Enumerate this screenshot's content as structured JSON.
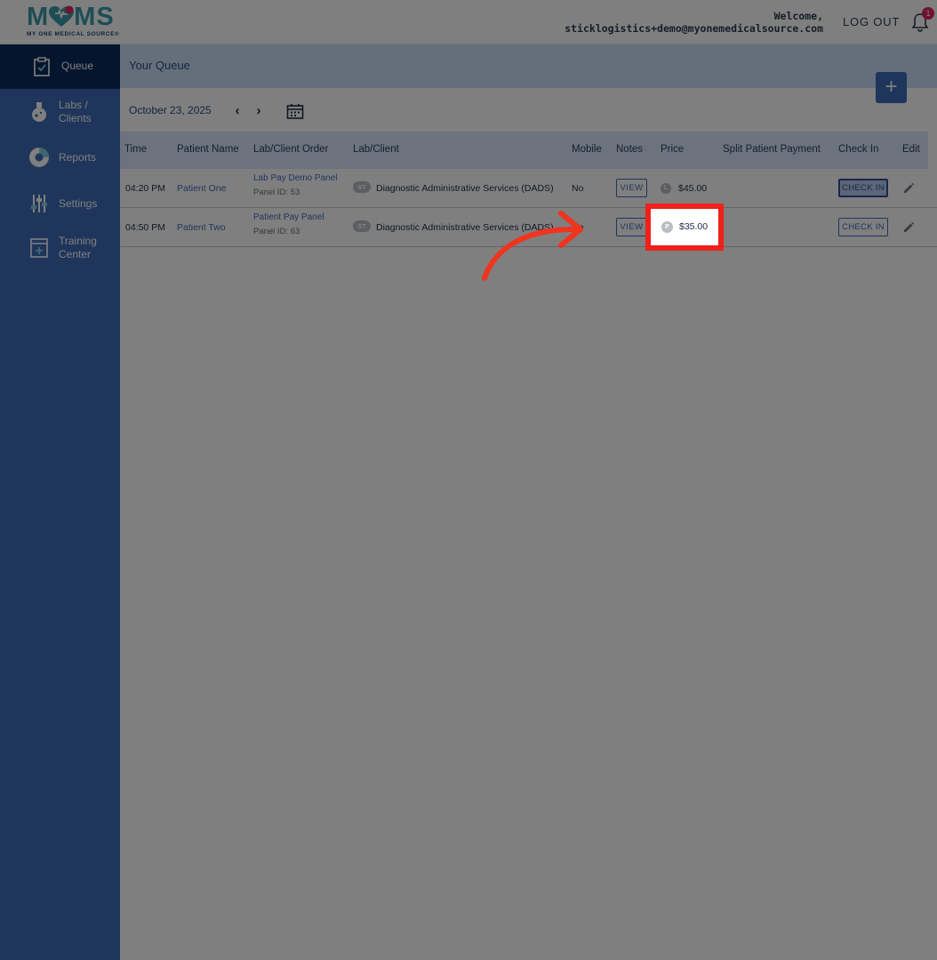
{
  "brand": {
    "logo_text_left": "M",
    "logo_text_right": "MS",
    "tagline": "MY ONE MEDICAL SOURCE®"
  },
  "header": {
    "welcome_label": "Welcome,",
    "user_email": "sticklogistics+demo@myonemedicalsource.com",
    "logout_label": "LOG OUT",
    "notification_count": "1"
  },
  "sidebar": {
    "items": [
      {
        "label": "Queue",
        "icon": "clipboard-check-icon",
        "active": true
      },
      {
        "label": "Labs /\nClients",
        "icon": "flask-icon"
      },
      {
        "label": "Reports",
        "icon": "pie-chart-icon"
      },
      {
        "label": "Settings",
        "icon": "sliders-icon"
      },
      {
        "label": "Training\nCenter",
        "icon": "training-book-icon"
      }
    ]
  },
  "main": {
    "title": "Your Queue",
    "add_label": "+",
    "date": "October 23, 2025",
    "prev_label": "‹",
    "next_label": "›"
  },
  "table": {
    "headers": {
      "time": "Time",
      "patient": "Patient Name",
      "order": "Lab/Client Order",
      "lab": "Lab/Client",
      "mobile": "Mobile",
      "notes": "Notes",
      "price": "Price",
      "split": "Split Patient Payment",
      "checkin": "Check In",
      "edit": "Edit"
    },
    "rows": [
      {
        "time": "04:20 PM",
        "patient": "Patient One",
        "order": "Lab Pay Demo Panel",
        "panel_id": "Panel ID: 53",
        "badge": "ST",
        "lab": "Diagnostic Administrative Services (DADS)",
        "mobile": "No",
        "notes": "VIEW",
        "price_badge": "L",
        "price": "$45.00",
        "checkin": "CHECK IN"
      },
      {
        "time": "04:50 PM",
        "patient": "Patient Two",
        "order": "Patient Pay Panel",
        "panel_id": "Panel ID: 63",
        "badge": "ST",
        "lab": "Diagnostic Administrative Services (DADS)",
        "mobile": "No",
        "notes": "VIEW",
        "price_badge": "P",
        "price": "$35.00",
        "checkin": "CHECK IN"
      }
    ]
  },
  "colors": {
    "sidebar": "#3f6bb8",
    "sidebar_active": "#0c2a5c",
    "accent": "#3f6bb8",
    "highlight": "#f0201a"
  }
}
